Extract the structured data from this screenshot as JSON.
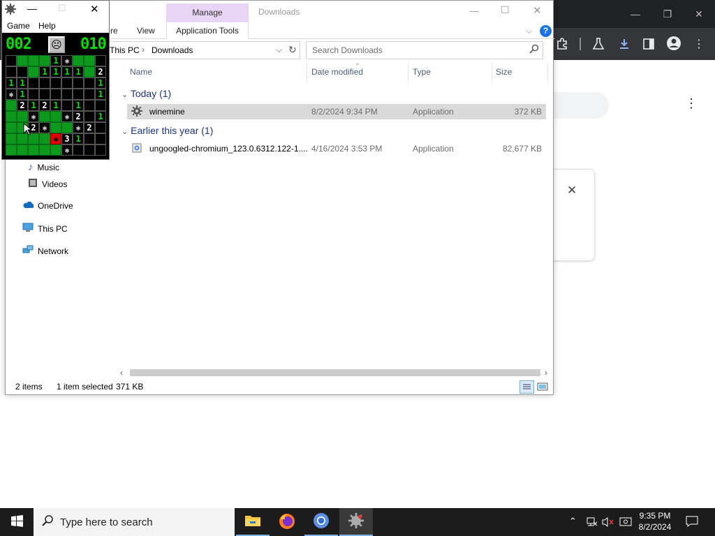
{
  "explorer": {
    "title": "Downloads",
    "ribbon": {
      "contextual_tab": "Manage",
      "tabs": [
        "re",
        "View"
      ],
      "app_tools": "Application Tools",
      "help": "?"
    },
    "breadcrumb": [
      "This PC",
      "Downloads"
    ],
    "search_placeholder": "Search Downloads",
    "columns": [
      "Name",
      "Date modified",
      "Type",
      "Size"
    ],
    "groups": [
      {
        "label": "Today (1)",
        "files": [
          {
            "name": "winemine",
            "date": "8/2/2024 9:34 PM",
            "type": "Application",
            "size": "372 KB",
            "selected": true
          }
        ]
      },
      {
        "label": "Earlier this year (1)",
        "files": [
          {
            "name": "ungoogled-chromium_123.0.6312.122-1....",
            "date": "4/16/2024 3:53 PM",
            "type": "Application",
            "size": "82,677 KB",
            "selected": false
          }
        ]
      }
    ],
    "nav": [
      {
        "label": "Music",
        "icon": "music-icon"
      },
      {
        "label": "Videos",
        "icon": "videos-icon"
      },
      {
        "label": "OneDrive",
        "icon": "onedrive-icon"
      },
      {
        "label": "This PC",
        "icon": "this-pc-icon"
      },
      {
        "label": "Network",
        "icon": "network-icon"
      }
    ],
    "status": {
      "count": "2 items",
      "selection": "1 item selected",
      "size": "371 KB"
    }
  },
  "minesweeper": {
    "menu": [
      "Game",
      "Help"
    ],
    "mine_counter": "002",
    "timer": "010",
    "grid": [
      "  ...1*..",
      "   .1111.2",
      "11      1*",
      "*1      11",
      ".2121 1   ",
      ". .*. .*2 11",
      ". .2*. .*2",
      ". . . .X31",
      ". . . . .*"
    ]
  },
  "taskbar": {
    "search_placeholder": "Type here to search",
    "time": "9:35 PM",
    "date": "8/2/2024"
  },
  "colors": {
    "manage_tab": "#e8d5f5",
    "selection": "#d9d9d9",
    "group_header": "#1e3287",
    "mine_hidden": "#0b9a1e",
    "mine_lcd": "#00e000",
    "mine_exploded": "#e00000"
  }
}
